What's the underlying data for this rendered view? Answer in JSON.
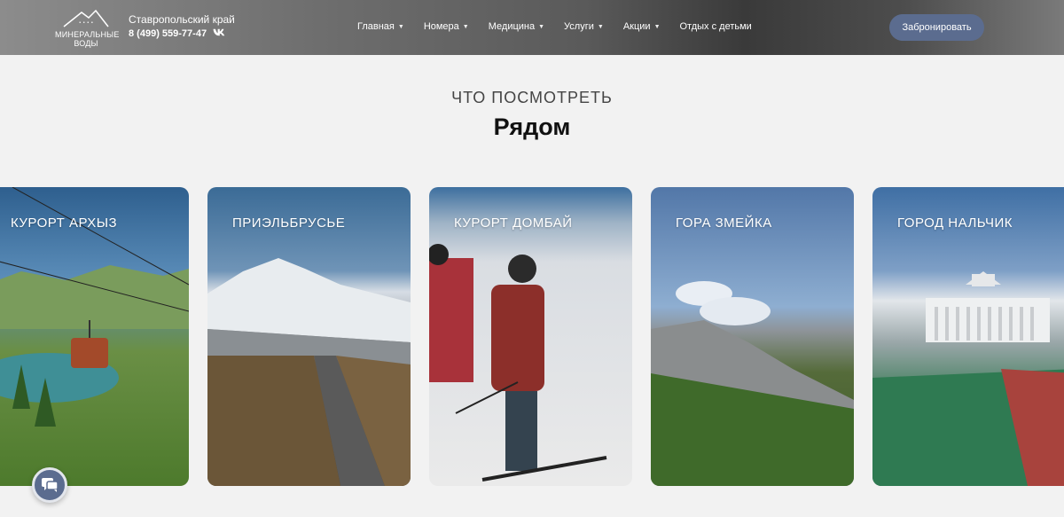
{
  "header": {
    "logo_script": "Ставрополь",
    "logo_line1": "МИНЕРАЛЬНЫЕ",
    "logo_line2": "ВОДЫ",
    "region": "Ставропольский край",
    "phone": "8 (499) 559-77-47",
    "vk_label": "VK",
    "nav": [
      {
        "label": "Главная",
        "has_dropdown": true
      },
      {
        "label": "Номера",
        "has_dropdown": true
      },
      {
        "label": "Медицина",
        "has_dropdown": true
      },
      {
        "label": "Услуги",
        "has_dropdown": true
      },
      {
        "label": "Акции",
        "has_dropdown": true
      },
      {
        "label": "Отдых с детьми",
        "has_dropdown": false
      }
    ],
    "book_button": "Забронировать",
    "accent_color": "#5b6c8f"
  },
  "section": {
    "subtitle": "ЧТО ПОСМОТРЕТЬ",
    "title": "Рядом"
  },
  "cards": [
    {
      "label": "КУРОРТ АРХЫЗ",
      "image": "mountain-lake-cable-car"
    },
    {
      "label": "ПРИЭЛЬБРУСЬЕ",
      "image": "snow-mountain-road"
    },
    {
      "label": "КУРОРТ ДОМБАЙ",
      "image": "skiers-snow-slope"
    },
    {
      "label": "ГОРА ЗМЕЙКА",
      "image": "green-mountain-forest"
    },
    {
      "label": "ГОРОД НАЛЬЧИК",
      "image": "city-fountain-building"
    }
  ],
  "chat": {
    "icon": "chat-icon"
  }
}
